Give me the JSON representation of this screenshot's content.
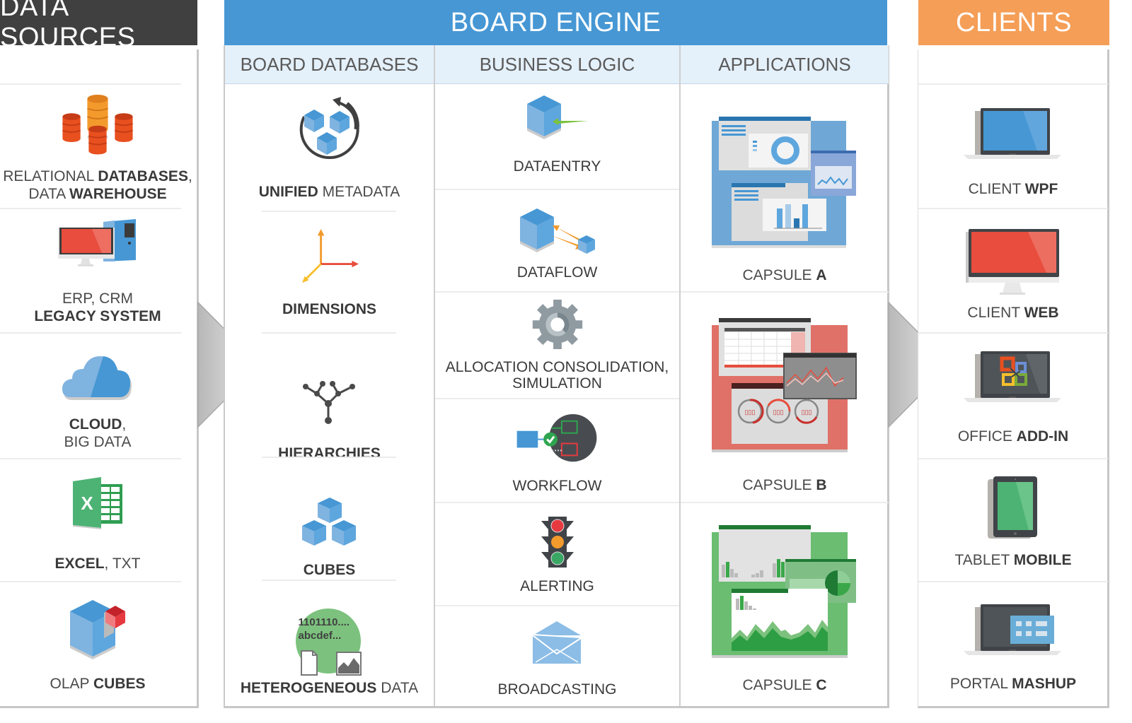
{
  "headers": {
    "sources": "DATA SOURCES",
    "engine": "BOARD ENGINE",
    "clients": "CLIENTS"
  },
  "engine_columns": [
    "BOARD DATABASES",
    "BUSINESS LOGIC",
    "APPLICATIONS"
  ],
  "colors": {
    "sources_header": "#404040",
    "engine_header": "#4697d4",
    "clients_header": "#f59e57",
    "subheader_bg": "#e4f0fa"
  },
  "data_sources": [
    {
      "icon": "database-stack-icon",
      "line1": [
        {
          "t": "RELATIONAL ",
          "w": "light"
        },
        {
          "t": "DATABASES",
          "w": "bold"
        },
        {
          "t": ",",
          "w": "light"
        }
      ],
      "line2": [
        {
          "t": "DATA ",
          "w": "light"
        },
        {
          "t": "WAREHOUSE",
          "w": "bold"
        }
      ]
    },
    {
      "icon": "desktop-computer-icon",
      "line1": [
        {
          "t": "ERP, CRM",
          "w": "light"
        }
      ],
      "line2": [
        {
          "t": "LEGACY SYSTEM",
          "w": "bold"
        }
      ]
    },
    {
      "icon": "cloud-icon",
      "line1": [
        {
          "t": "CLOUD",
          "w": "bold"
        },
        {
          "t": ",",
          "w": "light"
        }
      ],
      "line2": [
        {
          "t": "BIG DATA",
          "w": "light"
        }
      ]
    },
    {
      "icon": "excel-icon",
      "line1": [
        {
          "t": "EXCEL",
          "w": "bold"
        },
        {
          "t": ", TXT",
          "w": "light"
        }
      ],
      "line2": []
    },
    {
      "icon": "olap-cube-icon",
      "line1": [
        {
          "t": "OLAP ",
          "w": "light"
        },
        {
          "t": "CUBES",
          "w": "bold"
        }
      ],
      "line2": []
    }
  ],
  "board_databases": [
    {
      "icon": "unified-metadata-icon",
      "parts": [
        {
          "t": "UNIFIED ",
          "w": "bold"
        },
        {
          "t": " METADATA",
          "w": "light"
        }
      ]
    },
    {
      "icon": "dimensions-axes-icon",
      "parts": [
        {
          "t": "DIMENSIONS",
          "w": "bold"
        }
      ]
    },
    {
      "icon": "hierarchy-tree-icon",
      "parts": [
        {
          "t": "HIERARCHIES",
          "w": "bold"
        }
      ]
    },
    {
      "icon": "cubes-icon",
      "parts": [
        {
          "t": "CUBES",
          "w": "bold"
        }
      ]
    },
    {
      "icon": "heterogeneous-data-icon",
      "parts": [
        {
          "t": "HETEROGENEOUS ",
          "w": "bold"
        },
        {
          "t": " DATA",
          "w": "light"
        }
      ],
      "badge_line1": "1101110....",
      "badge_line2": "abcdef..."
    }
  ],
  "business_logic": [
    {
      "icon": "dataentry-cube-icon",
      "line1": "DATAENTRY",
      "line2": ""
    },
    {
      "icon": "dataflow-cubes-icon",
      "line1": "DATAFLOW",
      "line2": ""
    },
    {
      "icon": "gear-icon",
      "line1": "ALLOCATION  CONSOLIDATION,",
      "line2": "SIMULATION"
    },
    {
      "icon": "workflow-icon",
      "line1": "WORKFLOW",
      "line2": ""
    },
    {
      "icon": "traffic-light-icon",
      "line1": "ALERTING",
      "line2": ""
    },
    {
      "icon": "envelope-icon",
      "line1": "BROADCASTING",
      "line2": ""
    }
  ],
  "applications": [
    {
      "icon": "capsule-dashboard-blue-icon",
      "prefix": "CAPSULE ",
      "suffix": "A"
    },
    {
      "icon": "capsule-dashboard-red-icon",
      "prefix": "CAPSULE ",
      "suffix": "B"
    },
    {
      "icon": "capsule-dashboard-green-icon",
      "prefix": "CAPSULE ",
      "suffix": "C"
    }
  ],
  "clients": [
    {
      "icon": "laptop-blue-icon",
      "prefix": "CLIENT ",
      "suffix": "WPF"
    },
    {
      "icon": "monitor-red-icon",
      "prefix": "CLIENT ",
      "suffix": "WEB"
    },
    {
      "icon": "laptop-office-icon",
      "prefix": "OFFICE ",
      "suffix": "ADD-IN"
    },
    {
      "icon": "tablet-green-icon",
      "prefix": "TABLET ",
      "suffix": "MOBILE"
    },
    {
      "icon": "laptop-portal-icon",
      "prefix": "PORTAL ",
      "suffix": "MASHUP"
    }
  ]
}
